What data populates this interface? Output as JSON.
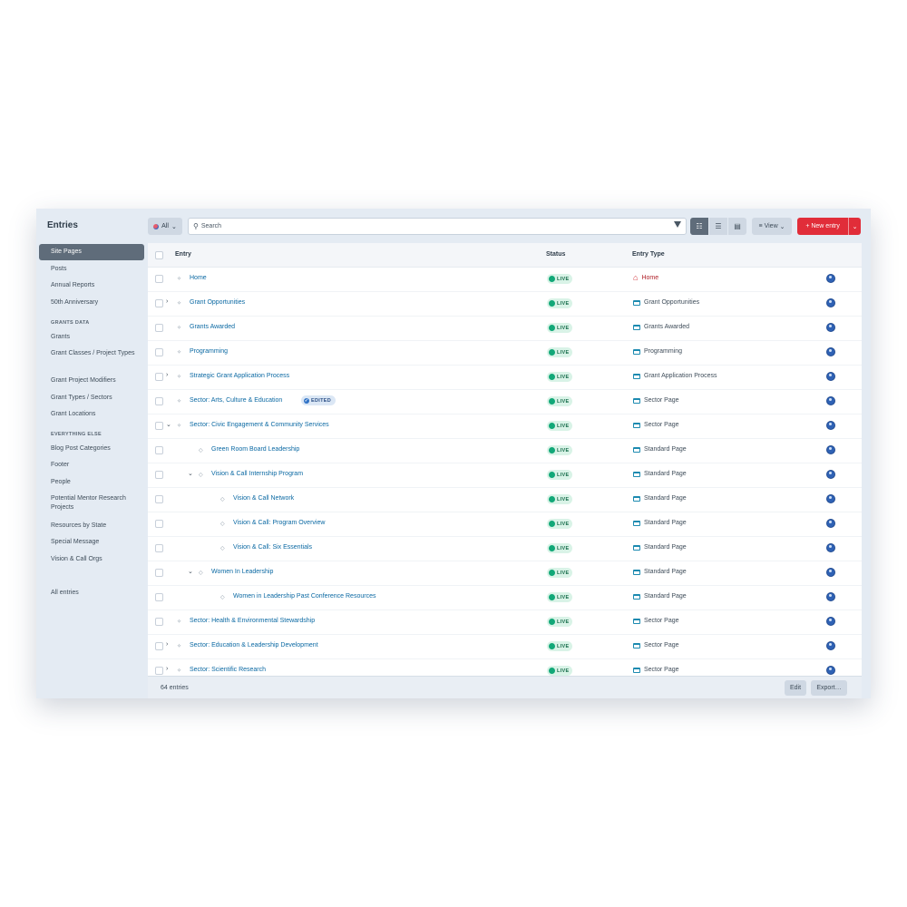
{
  "sidebar": {
    "title": "Entries",
    "items": [
      {
        "label": "Site Pages",
        "selected": true
      },
      {
        "label": "Posts"
      },
      {
        "label": "Annual Reports"
      },
      {
        "label": "50th Anniversary"
      }
    ],
    "heading_grants": "GRANTS DATA",
    "grant_items": [
      {
        "label": "Grants"
      },
      {
        "label": "Grant Classes / Project Types"
      },
      {
        "label": "Grant Project Modifiers"
      },
      {
        "label": "Grant Types / Sectors"
      },
      {
        "label": "Grant Locations"
      }
    ],
    "heading_else": "EVERYTHING ELSE",
    "else_items": [
      {
        "label": "Blog Post Categories"
      },
      {
        "label": "Footer"
      },
      {
        "label": "People"
      },
      {
        "label": "Potential Mentor Research Projects"
      },
      {
        "label": "Resources by State"
      },
      {
        "label": "Special Message"
      },
      {
        "label": "Vision & Call Orgs"
      }
    ],
    "all_entries": "All entries"
  },
  "toolbar": {
    "site_label": "All",
    "search_placeholder": "Search",
    "view_label": "View",
    "new_entry_label": "New entry"
  },
  "table": {
    "col_entry": "Entry",
    "col_status": "Status",
    "col_type": "Entry Type",
    "rows": [
      {
        "title": "Home",
        "status": "LIVE",
        "type": "Home",
        "level": 1,
        "toggle": ""
      },
      {
        "title": "Grant Opportunities",
        "status": "LIVE",
        "type": "Grant Opportunities",
        "level": 1,
        "toggle": "collapsed"
      },
      {
        "title": "Grants Awarded",
        "status": "LIVE",
        "type": "Grants Awarded",
        "level": 1,
        "toggle": ""
      },
      {
        "title": "Programming",
        "status": "LIVE",
        "type": "Programming",
        "level": 1,
        "toggle": ""
      },
      {
        "title": "Strategic Grant Application Process",
        "status": "LIVE",
        "type": "Grant Application Process",
        "level": 1,
        "toggle": "collapsed"
      },
      {
        "title": "Sector: Arts, Culture & Education",
        "status": "LIVE",
        "type": "Sector Page",
        "level": 1,
        "toggle": "",
        "badge": "EDITED"
      },
      {
        "title": "Sector: Civic Engagement & Community Services",
        "status": "LIVE",
        "type": "Sector Page",
        "level": 1,
        "toggle": "expanded"
      },
      {
        "title": "Green Room Board Leadership",
        "status": "LIVE",
        "type": "Standard Page",
        "level": 2,
        "toggle": ""
      },
      {
        "title": "Vision & Call Internship Program",
        "status": "LIVE",
        "type": "Standard Page",
        "level": 2,
        "toggle": "expanded"
      },
      {
        "title": "Vision & Call Network",
        "status": "LIVE",
        "type": "Standard Page",
        "level": 3,
        "toggle": ""
      },
      {
        "title": "Vision & Call: Program Overview",
        "status": "LIVE",
        "type": "Standard Page",
        "level": 3,
        "toggle": ""
      },
      {
        "title": "Vision & Call: Six Essentials",
        "status": "LIVE",
        "type": "Standard Page",
        "level": 3,
        "toggle": ""
      },
      {
        "title": "Women In Leadership",
        "status": "LIVE",
        "type": "Standard Page",
        "level": 2,
        "toggle": "expanded"
      },
      {
        "title": "Women in Leadership Past Conference Resources",
        "status": "LIVE",
        "type": "Standard Page",
        "level": 3,
        "toggle": ""
      },
      {
        "title": "Sector: Health & Environmental Stewardship",
        "status": "LIVE",
        "type": "Sector Page",
        "level": 1,
        "toggle": ""
      },
      {
        "title": "Sector: Education & Leadership Development",
        "status": "LIVE",
        "type": "Sector Page",
        "level": 1,
        "toggle": "collapsed"
      },
      {
        "title": "Sector: Scientific Research",
        "status": "LIVE",
        "type": "Sector Page",
        "level": 1,
        "toggle": "collapsed"
      }
    ]
  },
  "footer": {
    "count": "64 entries",
    "edit_label": "Edit",
    "export_label": "Export…"
  },
  "colors": {
    "accent_red": "#e12d39",
    "link_blue": "#0b69a3",
    "live_green": "#12a878"
  }
}
